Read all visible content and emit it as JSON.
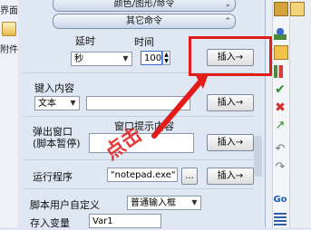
{
  "left_strip": {
    "top_label": "界面",
    "file_label": "附件"
  },
  "sections": {
    "color_bar": "颜色/图形/命令",
    "other_bar": "其它命令"
  },
  "delay": {
    "label_delay": "延时",
    "label_time": "时间",
    "unit_value": "秒",
    "time_value": "100",
    "insert_label": "插入→"
  },
  "key_input": {
    "label": "键入内容",
    "mode_value": "文本",
    "insert_label": "插入→"
  },
  "popup": {
    "label": "弹出窗口\n(脚本暂停)",
    "prompt_label": "窗口提示内容",
    "insert_label": "插入→"
  },
  "run_program": {
    "label": "运行程序",
    "value": "\"notepad.exe\"",
    "browse_label": "...",
    "insert_label": "插入→"
  },
  "script_custom": {
    "label": "脚本用户自定义",
    "mode_value": "普通输入框"
  },
  "store_var": {
    "label": "存入变量",
    "value": "Var1"
  },
  "annotation": {
    "text": "点击"
  },
  "colors": {
    "highlight": "#e21b1b",
    "panel_bg": "#dfe7f3"
  },
  "right_toolbar_icons": [
    "folder-icon",
    "person-icon",
    "folder-icon",
    "chart-icon",
    "check-icon",
    "cross-icon",
    "arrow-icon",
    "undo-icon",
    "redo-icon",
    "go-icon",
    "list-icon"
  ]
}
